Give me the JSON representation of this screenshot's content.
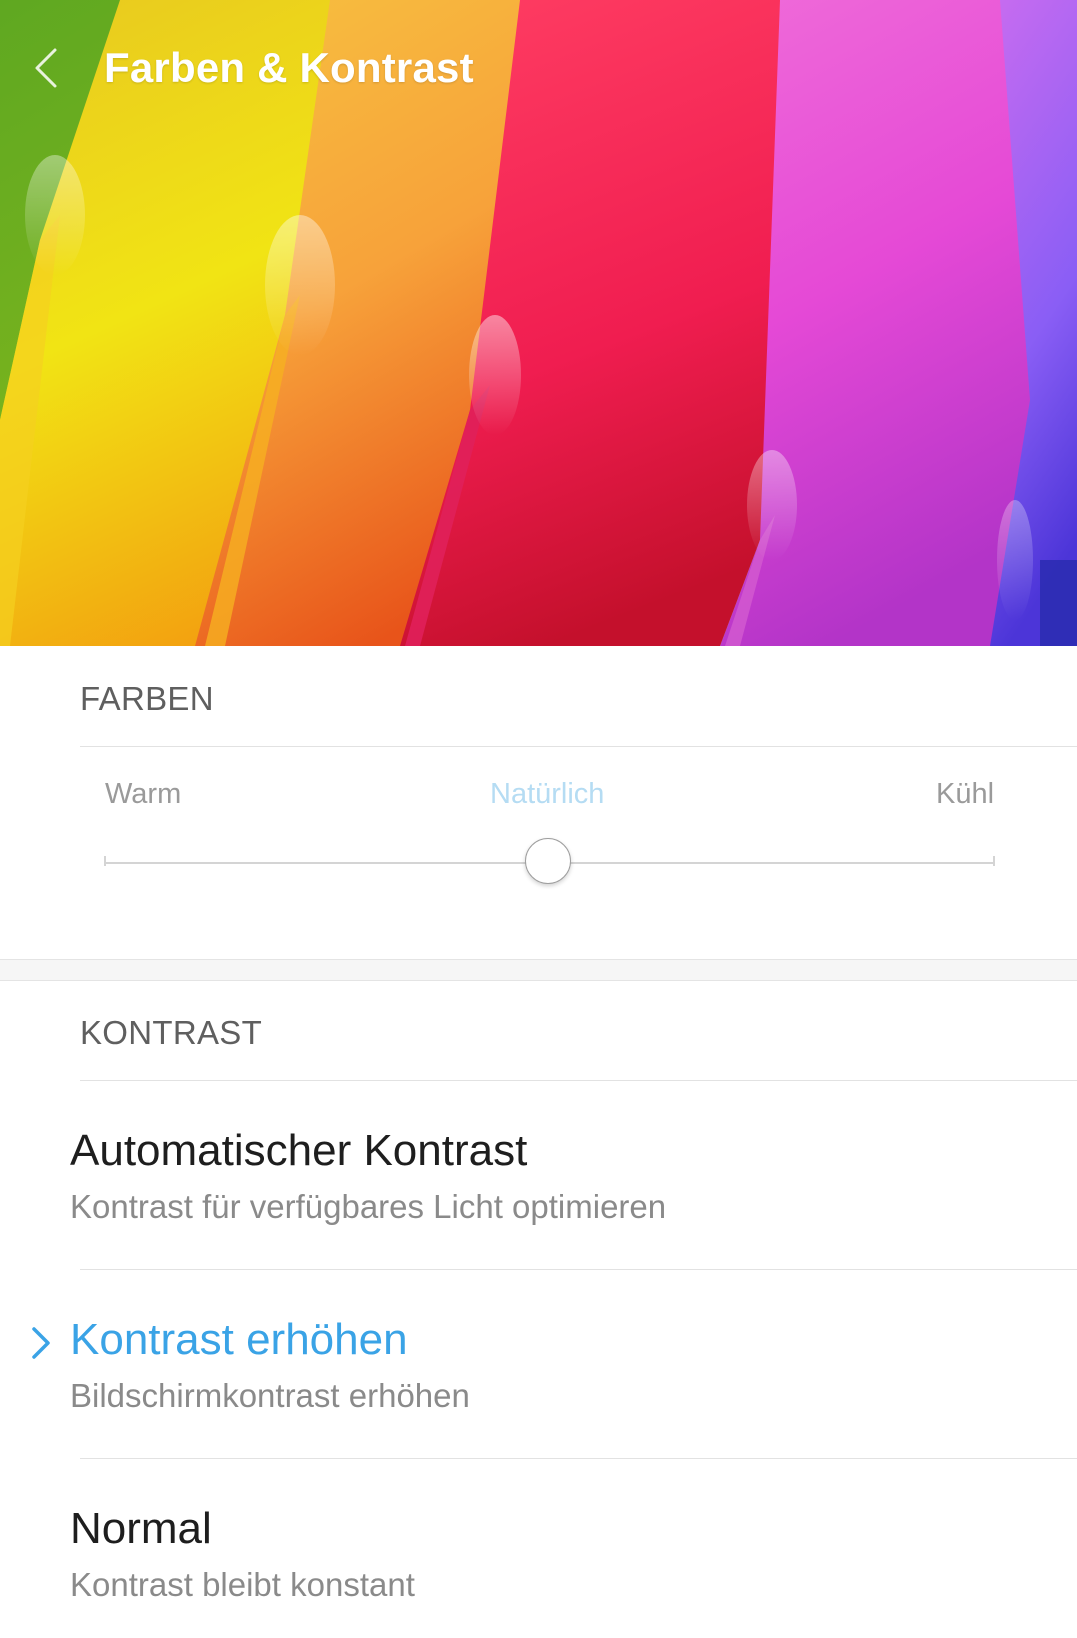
{
  "header": {
    "title": "Farben & Kontrast",
    "back_icon": "chevron-left-icon",
    "image": "colorful-paper-wallpaper"
  },
  "colors_section": {
    "header": "FARBEN",
    "slider": {
      "labels": [
        "Warm",
        "Natürlich",
        "Kühl"
      ],
      "selected_label": "Natürlich",
      "value_fraction": 0.5
    }
  },
  "contrast_section": {
    "header": "KONTRAST",
    "options": [
      {
        "title": "Automatischer Kontrast",
        "subtitle": "Kontrast für verfügbares Licht optimieren",
        "selected": false
      },
      {
        "title": "Kontrast erhöhen",
        "subtitle": "Bildschirmkontrast erhöhen",
        "selected": true
      },
      {
        "title": "Normal",
        "subtitle": "Kontrast bleibt konstant",
        "selected": false
      }
    ]
  },
  "theme": {
    "accent": "#3aa3e6",
    "text_primary": "#1e1e1e",
    "text_secondary": "#8a8a8a",
    "section_header": "#5f5f5f"
  }
}
